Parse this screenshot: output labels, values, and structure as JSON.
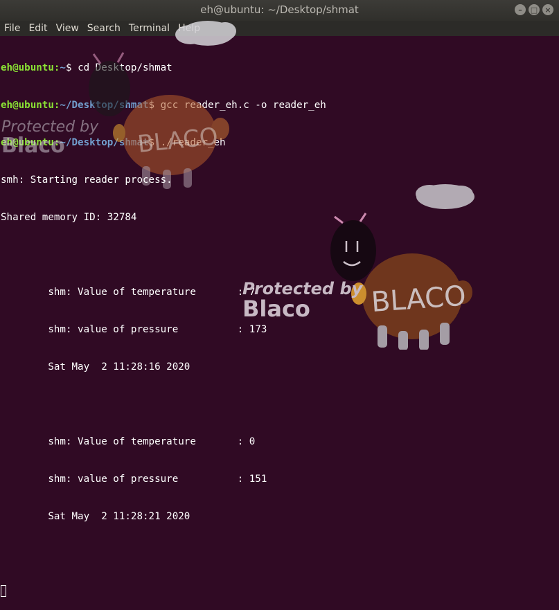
{
  "window": {
    "title": "eh@ubuntu: ~/Desktop/shmat",
    "minimize_label": "–",
    "maximize_label": "□",
    "close_label": "×"
  },
  "menu": [
    "File",
    "Edit",
    "View",
    "Search",
    "Terminal",
    "Help"
  ],
  "terminal": {
    "user_host": "eh@ubuntu",
    "prompt_line_1": {
      "path": "~",
      "command": "cd Desktop/shmat"
    },
    "prompt_line_2": {
      "path": "~/Desktop/shmat",
      "command": "gcc reader_eh.c -o reader_eh"
    },
    "prompt_line_3": {
      "path": "~/Desktop/shmat",
      "command": "./reader_eh"
    },
    "output": [
      "smh: Starting reader process.",
      "Shared memory ID: 32784",
      "",
      "        shm: Value of temperature       : 7",
      "        shm: value of pressure          : 173",
      "        Sat May  2 11:28:16 2020",
      "",
      "        shm: Value of temperature       : 0",
      "        shm: value of pressure          : 151",
      "        Sat May  2 11:28:21 2020",
      "",
      ""
    ]
  },
  "watermark": {
    "protected_by": "Protected by",
    "brand": "Blaco",
    "sheep_label": "BLACO"
  },
  "colors": {
    "terminal_bg": "#300a24",
    "prompt_user": "#8ae234",
    "prompt_path": "#729fcf",
    "text": "#ffffff"
  }
}
